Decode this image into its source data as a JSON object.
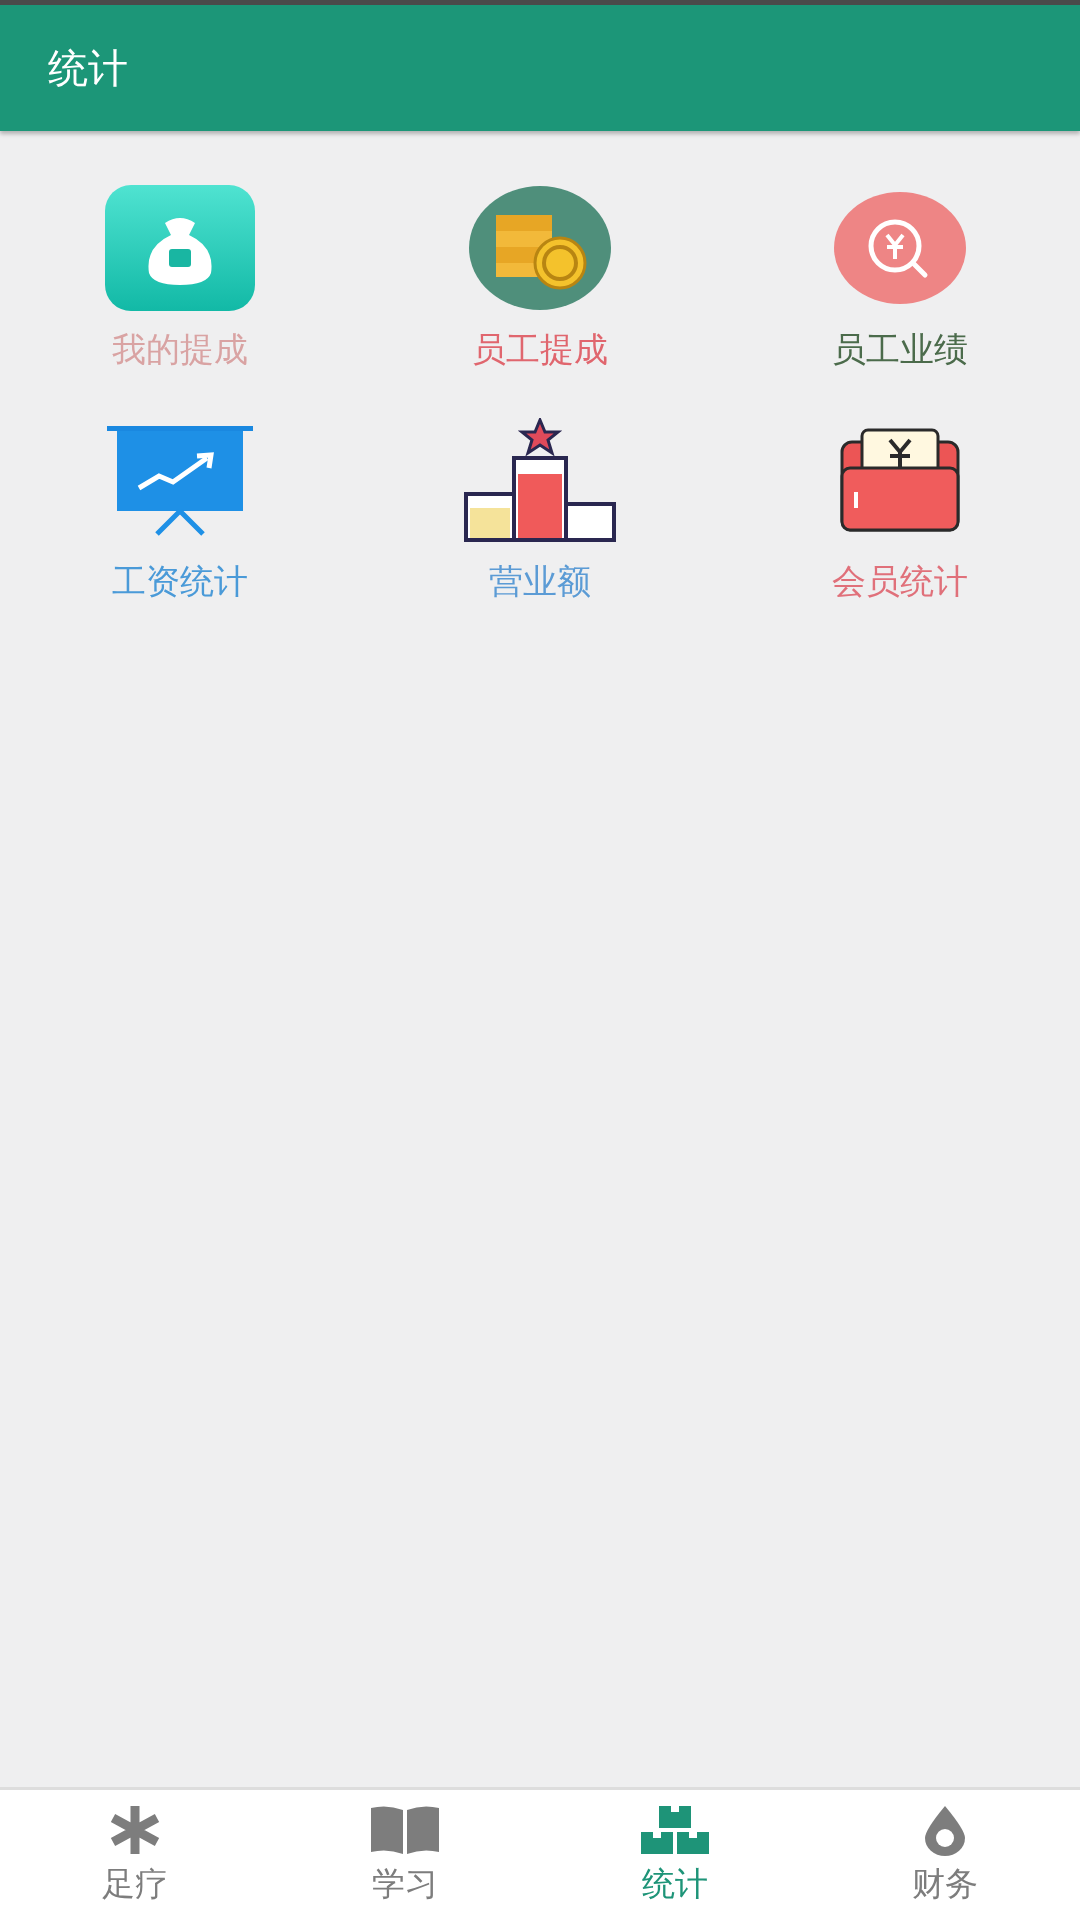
{
  "app_bar": {
    "title": "统计"
  },
  "shortcuts": [
    {
      "kind": "bag",
      "label": "我的提成",
      "color": "#d9a3a3"
    },
    {
      "kind": "coins",
      "label": "员工提成",
      "color": "#e0666e"
    },
    {
      "kind": "yen-search",
      "label": "员工业绩",
      "color": "#4b6b4b"
    },
    {
      "kind": "board",
      "label": "工资统计",
      "color": "#4a9ad8"
    },
    {
      "kind": "podium",
      "label": "营业额",
      "color": "#5b9bd5"
    },
    {
      "kind": "wallet",
      "label": "会员统计",
      "color": "#e0707a"
    }
  ],
  "bottom_nav": [
    {
      "kind": "asterisk",
      "label": "足疗",
      "selected": false
    },
    {
      "kind": "book",
      "label": "学习",
      "selected": false
    },
    {
      "kind": "boxes",
      "label": "统计",
      "selected": true
    },
    {
      "kind": "drop",
      "label": "财务",
      "selected": false
    }
  ]
}
